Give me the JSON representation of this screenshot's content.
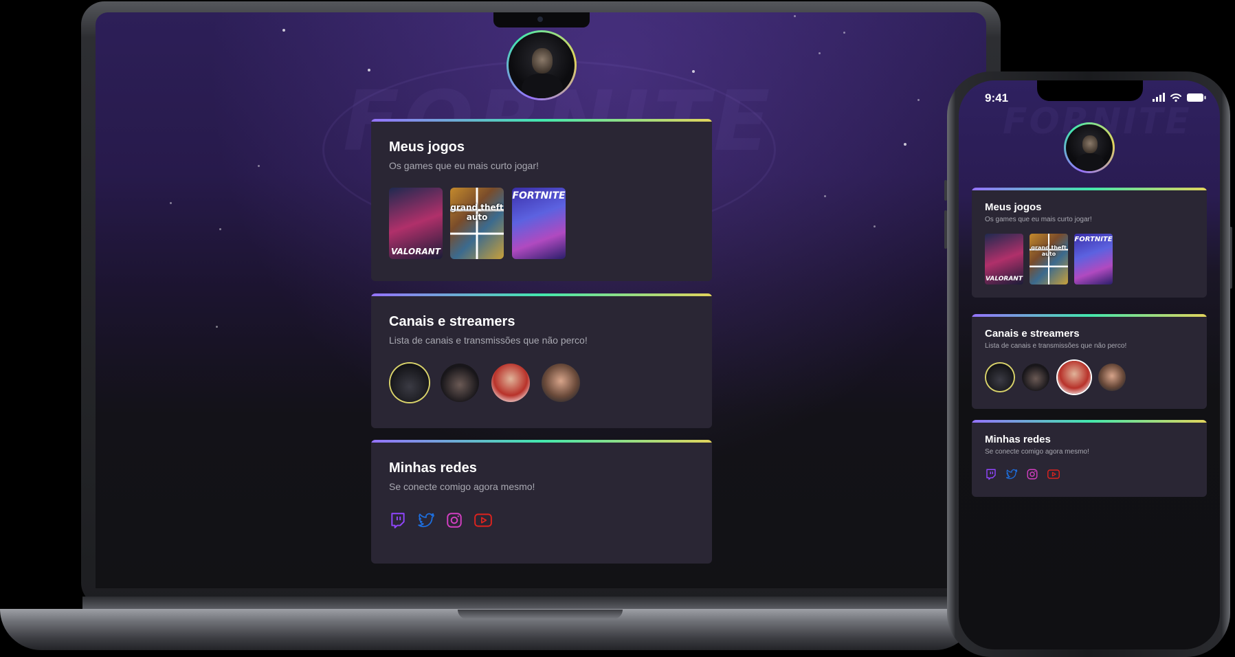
{
  "phone_status": {
    "time": "9:41"
  },
  "cards": {
    "games": {
      "title": "Meus jogos",
      "subtitle": "Os games que eu mais curto jogar!",
      "items": [
        {
          "name": "valorant-cover",
          "label": "VALORANT"
        },
        {
          "name": "gta-cover",
          "label": "grand theft auto"
        },
        {
          "name": "fortnite-cover",
          "label": "FORTNITE"
        }
      ]
    },
    "streamers": {
      "title": "Canais e streamers",
      "subtitle": "Lista de canais e transmissões que não perco!"
    },
    "networks": {
      "title": "Minhas redes",
      "subtitle": "Se conecte comigo agora mesmo!",
      "icons": [
        "twitch-icon",
        "twitter-icon",
        "instagram-icon",
        "youtube-icon"
      ]
    }
  },
  "colors": {
    "twitch": "#9146ff",
    "twitter": "#1d6fe0",
    "instagram": "#d43fc2",
    "youtube": "#e0231e",
    "card_bg": "#2a2634",
    "gradient": [
      "#9572fc",
      "#43e7ad",
      "#e2d45c"
    ]
  }
}
